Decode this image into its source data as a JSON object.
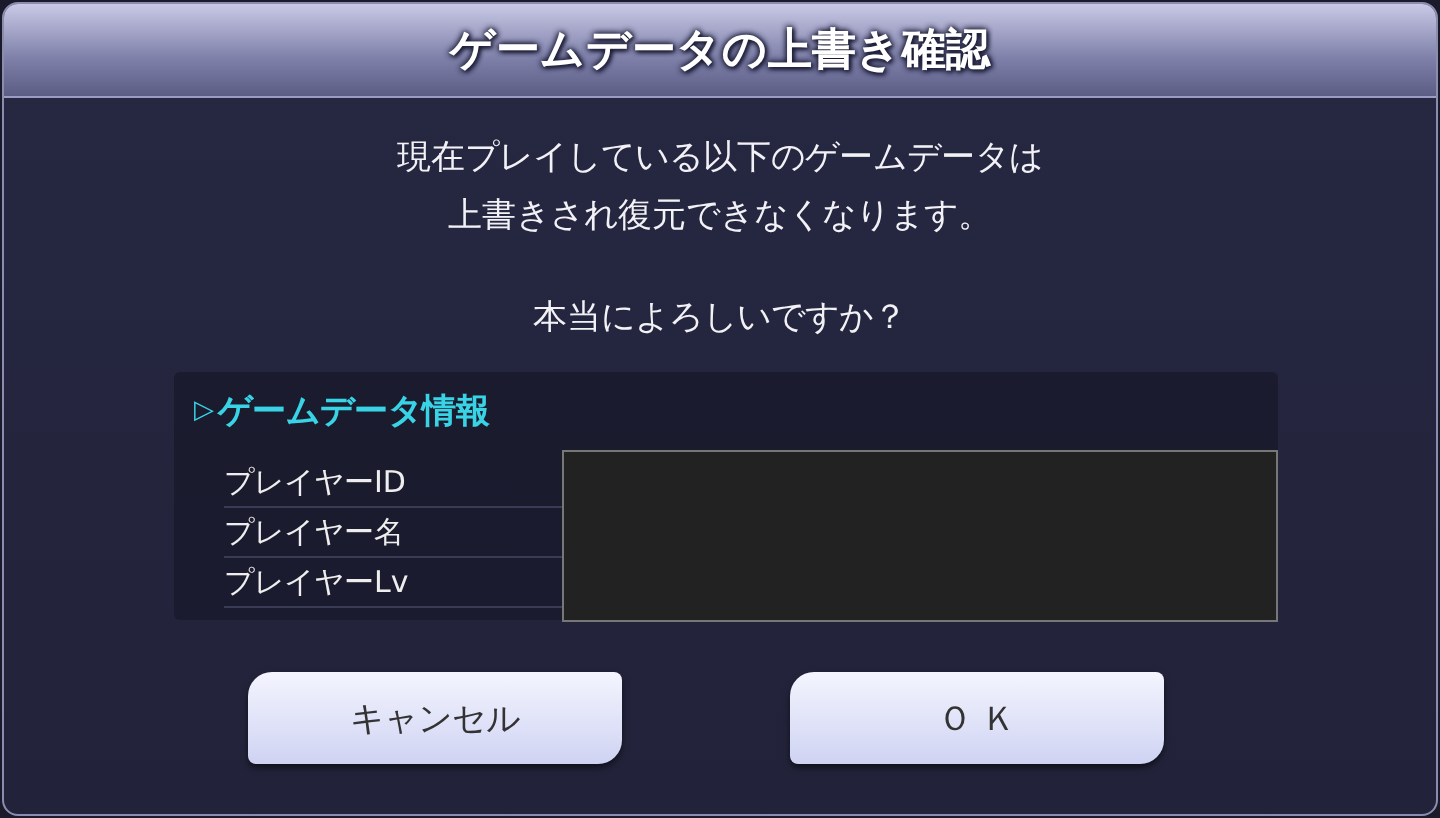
{
  "dialog": {
    "title": "ゲームデータの上書き確認",
    "message_lines": [
      "現在プレイしている以下のゲームデータは",
      "上書きされ復元できなくなります。"
    ],
    "question": "本当によろしいですか？",
    "info": {
      "marker": "▷",
      "heading": "ゲームデータ情報",
      "labels": [
        "プレイヤーID",
        "プレイヤー名",
        "プレイヤーLv"
      ]
    },
    "buttons": [
      {
        "label": "キャンセル"
      },
      {
        "label": "Ｏ Ｋ"
      }
    ]
  }
}
